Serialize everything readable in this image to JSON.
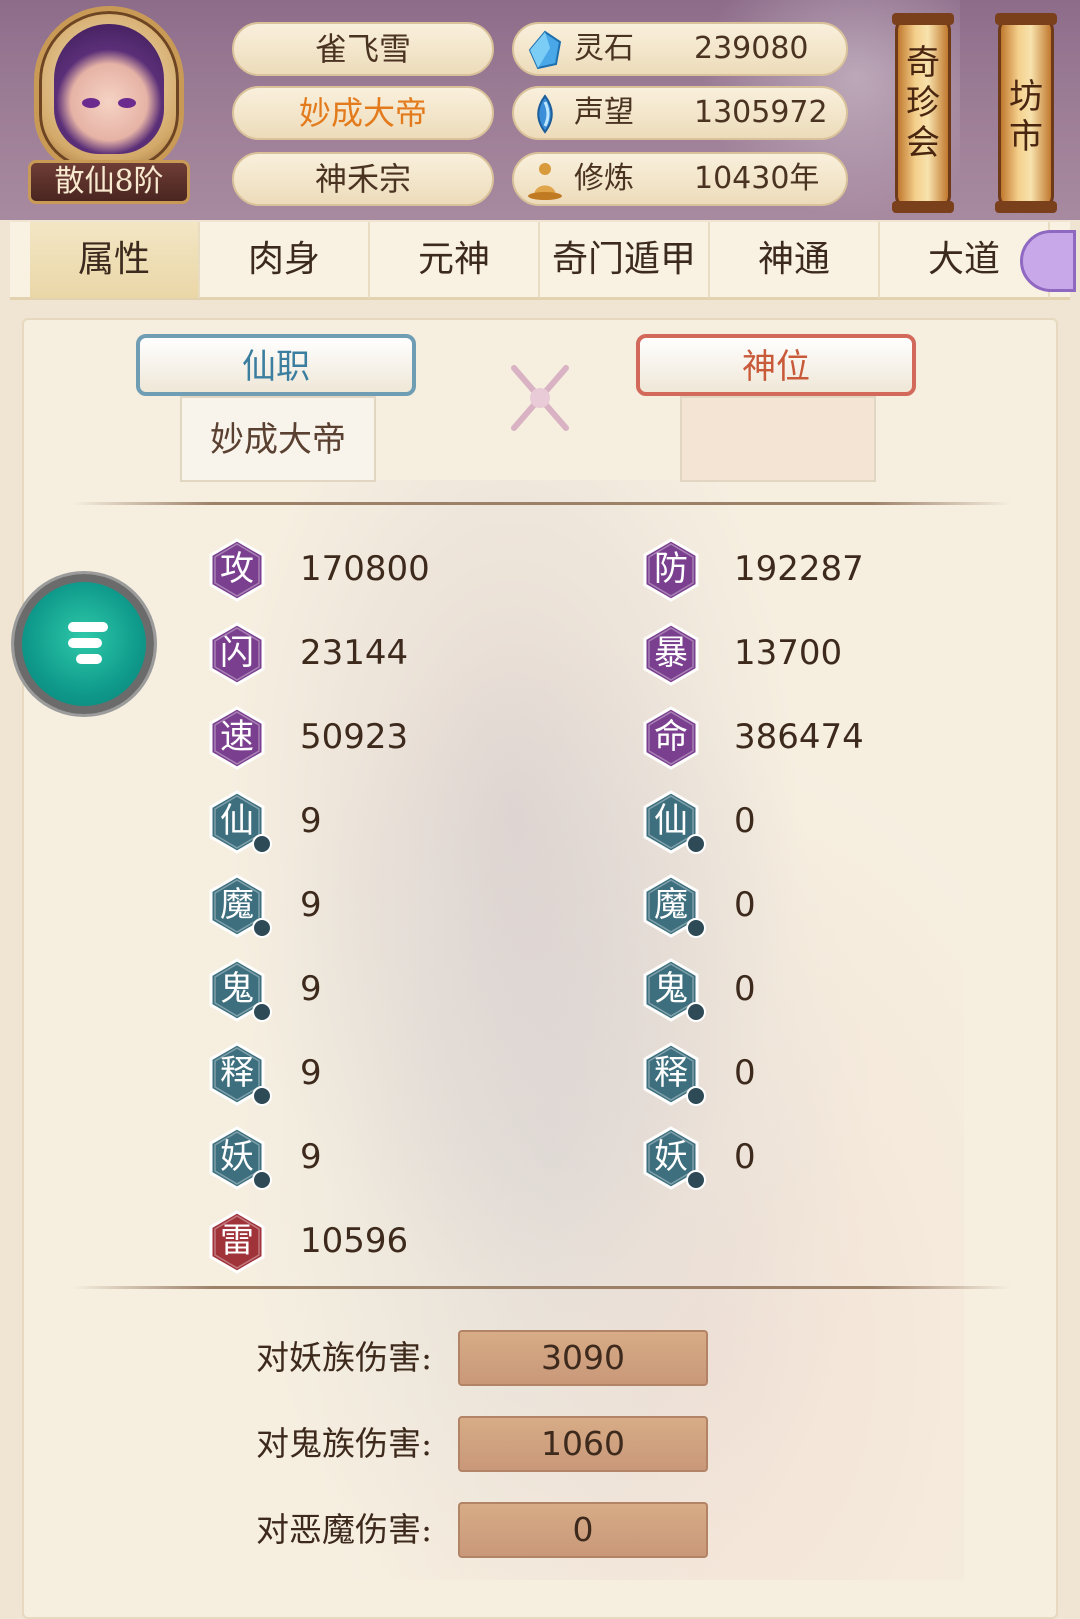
{
  "header": {
    "rank": "散仙8阶",
    "name": "雀飞雪",
    "title": "妙成大帝",
    "sect": "神禾宗",
    "resources": [
      {
        "label": "灵石",
        "value": "239080",
        "icon": "spirit-stone-icon",
        "color": "#4aa8e8"
      },
      {
        "label": "声望",
        "value": "1305972",
        "icon": "fame-icon",
        "color": "#3b8fd8"
      },
      {
        "label": "修炼",
        "value": "10430年",
        "icon": "meditation-icon",
        "color": "#d89a3a"
      }
    ],
    "lanterns": [
      "奇珍会",
      "坊市"
    ]
  },
  "tabs": [
    "属性",
    "肉身",
    "元神",
    "奇门遁甲",
    "神通",
    "大道"
  ],
  "rank_cards": {
    "fairy_job_label": "仙职",
    "fairy_job_value": "妙成大帝",
    "divine_label": "神位",
    "divine_value": ""
  },
  "stats_left": [
    {
      "char": "攻",
      "value": "170800"
    },
    {
      "char": "闪",
      "value": "23144"
    },
    {
      "char": "速",
      "value": "50923"
    },
    {
      "char": "仙",
      "value": "9"
    },
    {
      "char": "魔",
      "value": "9"
    },
    {
      "char": "鬼",
      "value": "9"
    },
    {
      "char": "释",
      "value": "9"
    },
    {
      "char": "妖",
      "value": "9"
    },
    {
      "char": "雷",
      "value": "10596"
    }
  ],
  "stats_right": [
    {
      "char": "防",
      "value": "192287"
    },
    {
      "char": "暴",
      "value": "13700"
    },
    {
      "char": "命",
      "value": "386474"
    },
    {
      "char": "仙",
      "value": "0"
    },
    {
      "char": "魔",
      "value": "0"
    },
    {
      "char": "鬼",
      "value": "0"
    },
    {
      "char": "释",
      "value": "0"
    },
    {
      "char": "妖",
      "value": "0"
    }
  ],
  "damage": [
    {
      "label": "对妖族伤害:",
      "value": "3090"
    },
    {
      "label": "对鬼族伤害:",
      "value": "1060"
    },
    {
      "label": "对恶魔伤害:",
      "value": "0"
    }
  ],
  "colors": {
    "hex_purple": "#7a3f8e",
    "hex_teal": "#3d6f7e",
    "hex_red": "#a0323a",
    "title_orange": "#e37b1d"
  }
}
